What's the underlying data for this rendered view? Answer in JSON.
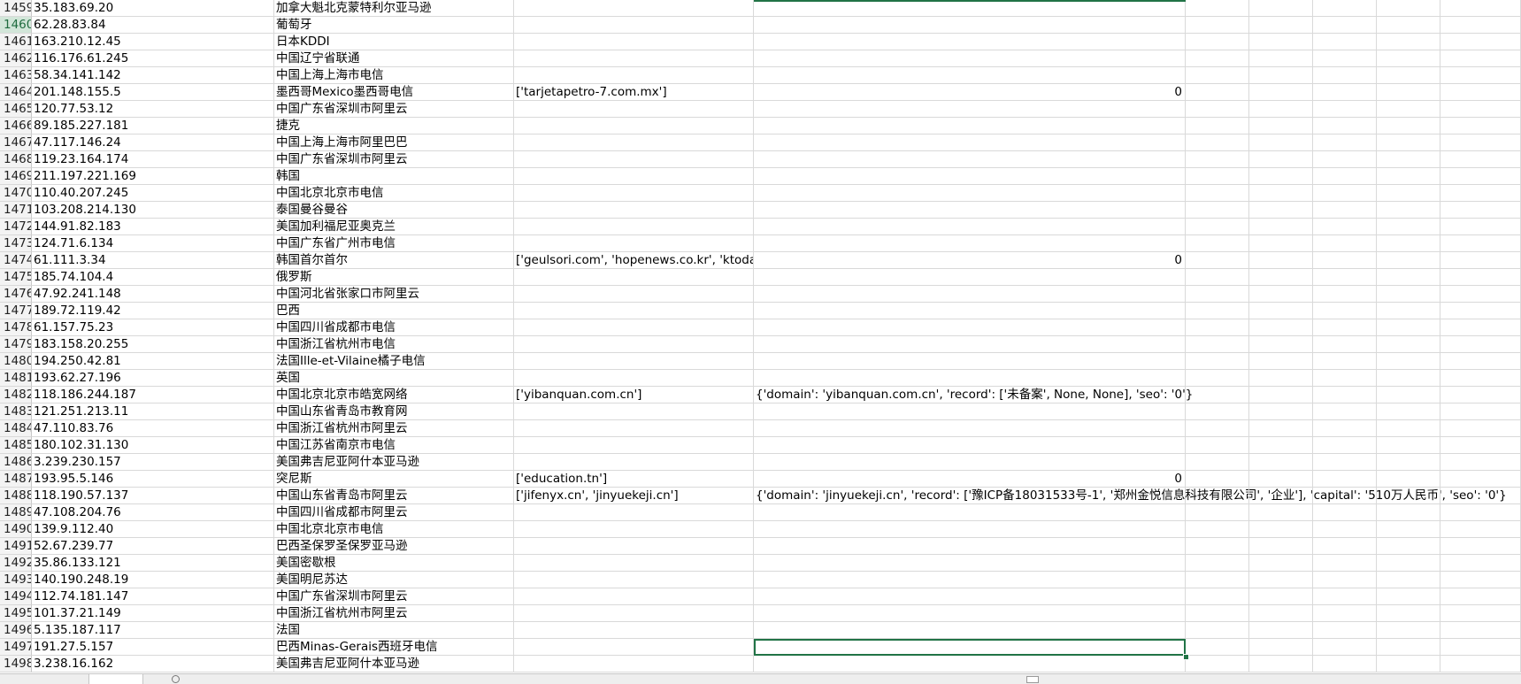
{
  "rows": [
    {
      "num": "1459",
      "ip": "35.183.69.20",
      "loc": "加拿大魁北克蒙特利尔亚马逊",
      "domains": "",
      "info": "",
      "info_is_number": false
    },
    {
      "num": "1460",
      "ip": "62.28.83.84",
      "loc": "葡萄牙",
      "domains": "",
      "info": "",
      "info_is_number": false
    },
    {
      "num": "1461",
      "ip": "163.210.12.45",
      "loc": "日本KDDI",
      "domains": "",
      "info": "",
      "info_is_number": false
    },
    {
      "num": "1462",
      "ip": "116.176.61.245",
      "loc": "中国辽宁省联通",
      "domains": "",
      "info": "",
      "info_is_number": false
    },
    {
      "num": "1463",
      "ip": "58.34.141.142",
      "loc": "中国上海上海市电信",
      "domains": "",
      "info": "",
      "info_is_number": false
    },
    {
      "num": "1464",
      "ip": "201.148.155.5",
      "loc": "墨西哥Mexico墨西哥电信",
      "domains": "['tarjetapetro-7.com.mx']",
      "info": "0",
      "info_is_number": true
    },
    {
      "num": "1465",
      "ip": "120.77.53.12",
      "loc": "中国广东省深圳市阿里云",
      "domains": "",
      "info": "",
      "info_is_number": false
    },
    {
      "num": "1466",
      "ip": "89.185.227.181",
      "loc": "捷克",
      "domains": "",
      "info": "",
      "info_is_number": false
    },
    {
      "num": "1467",
      "ip": "47.117.146.24",
      "loc": "中国上海上海市阿里巴巴",
      "domains": "",
      "info": "",
      "info_is_number": false
    },
    {
      "num": "1468",
      "ip": "119.23.164.174",
      "loc": "中国广东省深圳市阿里云",
      "domains": "",
      "info": "",
      "info_is_number": false
    },
    {
      "num": "1469",
      "ip": "211.197.221.169",
      "loc": "韩国",
      "domains": "",
      "info": "",
      "info_is_number": false
    },
    {
      "num": "1470",
      "ip": "110.40.207.245",
      "loc": "中国北京北京市电信",
      "domains": "",
      "info": "",
      "info_is_number": false
    },
    {
      "num": "1471",
      "ip": "103.208.214.130",
      "loc": "泰国曼谷曼谷",
      "domains": "",
      "info": "",
      "info_is_number": false
    },
    {
      "num": "1472",
      "ip": "144.91.82.183",
      "loc": "美国加利福尼亚奥克兰",
      "domains": "",
      "info": "",
      "info_is_number": false
    },
    {
      "num": "1473",
      "ip": "124.71.6.134",
      "loc": "中国广东省广州市电信",
      "domains": "",
      "info": "",
      "info_is_number": false
    },
    {
      "num": "1474",
      "ip": "61.111.3.34",
      "loc": "韩国首尔首尔",
      "domains": "['geulsori.com', 'hopenews.co.kr', 'ktoday.c",
      "info": "0",
      "info_is_number": true
    },
    {
      "num": "1475",
      "ip": "185.74.104.4",
      "loc": "俄罗斯",
      "domains": "",
      "info": "",
      "info_is_number": false
    },
    {
      "num": "1476",
      "ip": "47.92.241.148",
      "loc": "中国河北省张家口市阿里云",
      "domains": "",
      "info": "",
      "info_is_number": false
    },
    {
      "num": "1477",
      "ip": "189.72.119.42",
      "loc": "巴西",
      "domains": "",
      "info": "",
      "info_is_number": false
    },
    {
      "num": "1478",
      "ip": "61.157.75.23",
      "loc": "中国四川省成都市电信",
      "domains": "",
      "info": "",
      "info_is_number": false
    },
    {
      "num": "1479",
      "ip": "183.158.20.255",
      "loc": "中国浙江省杭州市电信",
      "domains": "",
      "info": "",
      "info_is_number": false
    },
    {
      "num": "1480",
      "ip": "194.250.42.81",
      "loc": "法国Ille-et-Vilaine橘子电信",
      "domains": "",
      "info": "",
      "info_is_number": false
    },
    {
      "num": "1481",
      "ip": "193.62.27.196",
      "loc": "英国",
      "domains": "",
      "info": "",
      "info_is_number": false
    },
    {
      "num": "1482",
      "ip": "118.186.244.187",
      "loc": "中国北京北京市皓宽网络",
      "domains": "['yibanquan.com.cn']",
      "info": "{'domain': 'yibanquan.com.cn', 'record': ['未备案', None, None], 'seo': '0'}",
      "info_is_number": false
    },
    {
      "num": "1483",
      "ip": "121.251.213.11",
      "loc": "中国山东省青岛市教育网",
      "domains": "",
      "info": "",
      "info_is_number": false
    },
    {
      "num": "1484",
      "ip": "47.110.83.76",
      "loc": "中国浙江省杭州市阿里云",
      "domains": "",
      "info": "",
      "info_is_number": false
    },
    {
      "num": "1485",
      "ip": "180.102.31.130",
      "loc": "中国江苏省南京市电信",
      "domains": "",
      "info": "",
      "info_is_number": false
    },
    {
      "num": "1486",
      "ip": "3.239.230.157",
      "loc": "美国弗吉尼亚阿什本亚马逊",
      "domains": "",
      "info": "",
      "info_is_number": false
    },
    {
      "num": "1487",
      "ip": "193.95.5.146",
      "loc": "突尼斯",
      "domains": "['education.tn']",
      "info": "0",
      "info_is_number": true
    },
    {
      "num": "1488",
      "ip": "118.190.57.137",
      "loc": "中国山东省青岛市阿里云",
      "domains": "['jifenyx.cn', 'jinyuekeji.cn']",
      "info": "{'domain': 'jinyuekeji.cn', 'record': ['豫ICP备18031533号-1', '郑州金悦信息科技有限公司', '企业'], 'capital': '510万人民币', 'seo': '0'}",
      "info_is_number": false
    },
    {
      "num": "1489",
      "ip": "47.108.204.76",
      "loc": "中国四川省成都市阿里云",
      "domains": "",
      "info": "",
      "info_is_number": false
    },
    {
      "num": "1490",
      "ip": "139.9.112.40",
      "loc": "中国北京北京市电信",
      "domains": "",
      "info": "",
      "info_is_number": false
    },
    {
      "num": "1491",
      "ip": "52.67.239.77",
      "loc": "巴西圣保罗圣保罗亚马逊",
      "domains": "",
      "info": "",
      "info_is_number": false
    },
    {
      "num": "1492",
      "ip": "35.86.133.121",
      "loc": "美国密歇根",
      "domains": "",
      "info": "",
      "info_is_number": false
    },
    {
      "num": "1493",
      "ip": "140.190.248.19",
      "loc": "美国明尼苏达",
      "domains": "",
      "info": "",
      "info_is_number": false
    },
    {
      "num": "1494",
      "ip": "112.74.181.147",
      "loc": "中国广东省深圳市阿里云",
      "domains": "",
      "info": "",
      "info_is_number": false
    },
    {
      "num": "1495",
      "ip": "101.37.21.149",
      "loc": "中国浙江省杭州市阿里云",
      "domains": "",
      "info": "",
      "info_is_number": false
    },
    {
      "num": "1496",
      "ip": "5.135.187.117",
      "loc": "法国",
      "domains": "",
      "info": "",
      "info_is_number": false
    },
    {
      "num": "1497",
      "ip": "191.27.5.157",
      "loc": "巴西Minas-Gerais西班牙电信",
      "domains": "",
      "info": "",
      "info_is_number": false
    },
    {
      "num": "1498",
      "ip": "3.238.16.162",
      "loc": "美国弗吉尼亚阿什本亚马逊",
      "domains": "",
      "info": "",
      "info_is_number": false
    }
  ],
  "selected_row": "1460",
  "active_row": "1497",
  "colors": {
    "accent": "#217346",
    "gridline": "#d9d9d9",
    "row_header_bg": "#f3f3f3",
    "selected_header_bg": "#d2e6d9"
  }
}
